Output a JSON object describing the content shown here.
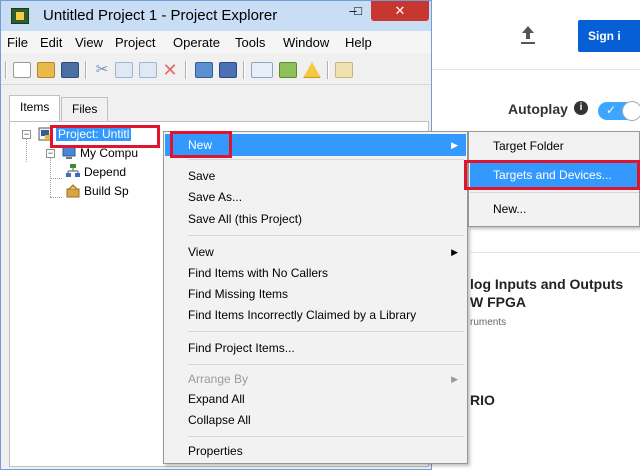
{
  "window": {
    "title": "Untitled Project 1 - Project Explorer",
    "close_label": "✕",
    "minimize_label": "–",
    "maximize_label": "□"
  },
  "menubar": {
    "items": [
      "File",
      "Edit",
      "View",
      "Project",
      "Operate",
      "Tools",
      "Window",
      "Help"
    ]
  },
  "tabs": [
    {
      "label": "Items"
    },
    {
      "label": "Files"
    }
  ],
  "tree": {
    "project": "Project: Untitl",
    "computer": "My Compu",
    "dependencies": "Depend",
    "build": "Build Sp"
  },
  "context_menu": {
    "new": "New",
    "save": "Save",
    "save_as": "Save As...",
    "save_all": "Save All (this Project)",
    "view": "View",
    "find_no_callers": "Find Items with No Callers",
    "find_missing": "Find Missing Items",
    "find_incorrectly_claimed": "Find Items Incorrectly Claimed by a Library",
    "find_project_items": "Find Project Items...",
    "arrange_by": "Arrange By",
    "expand_all": "Expand All",
    "collapse_all": "Collapse All",
    "properties": "Properties"
  },
  "submenu": {
    "target_folder": "Target Folder",
    "targets_devices": "Targets and Devices...",
    "new": "New..."
  },
  "background_page": {
    "signin": "Sign i",
    "autoplay": "Autoplay",
    "info": "i",
    "rec_title_line1": "log Inputs and Outputs",
    "rec_title_line2": "W FPGA",
    "rec_sub": "ruments",
    "rec_title2": "RIO"
  },
  "colors": {
    "highlight": "#3399ff",
    "annotation_red": "#e0142f",
    "signin_blue": "#065fd4",
    "close_red": "#c7372f",
    "toggle_blue": "#3ea6ff"
  }
}
